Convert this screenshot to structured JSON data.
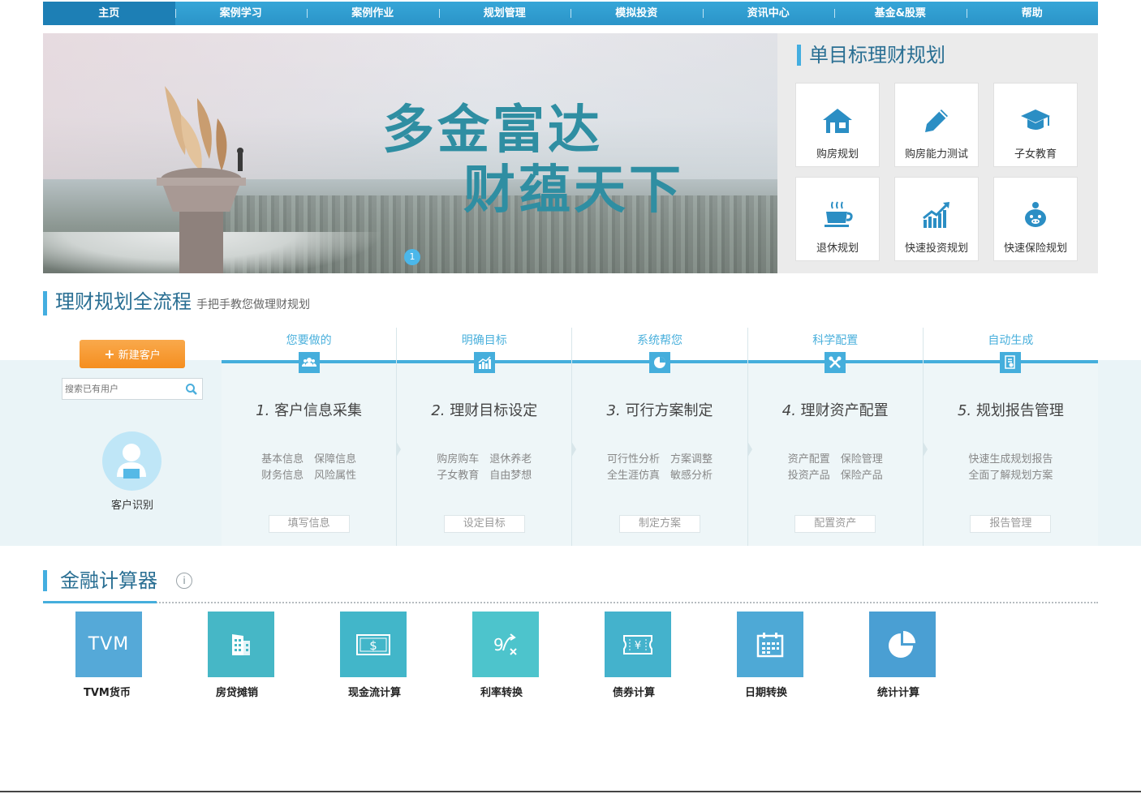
{
  "nav": {
    "items": [
      "主页",
      "案例学习",
      "案例作业",
      "规划管理",
      "模拟投资",
      "资讯中心",
      "基金&股票",
      "帮助"
    ]
  },
  "banner": {
    "slogan_line1": "多金富达",
    "slogan_line2": "财蕴天下",
    "slide_indicator": "1"
  },
  "goal_panel": {
    "title": "单目标理财规划",
    "items": [
      {
        "label": "购房规划",
        "icon": "house-icon"
      },
      {
        "label": "购房能力测试",
        "icon": "pencil-icon"
      },
      {
        "label": "子女教育",
        "icon": "graduation-cap-icon"
      },
      {
        "label": "退休规划",
        "icon": "coffee-cup-icon"
      },
      {
        "label": "快速投资规划",
        "icon": "rising-chart-icon"
      },
      {
        "label": "快速保险规划",
        "icon": "piggy-bank-icon"
      }
    ]
  },
  "process": {
    "title": "理财规划全流程",
    "subtitle": "手把手教您做理财规划",
    "new_client_label": "新建客户",
    "search_placeholder": "搜索已有用户",
    "client_id_label": "客户识别",
    "steps": [
      {
        "head": "您要做的",
        "num": "1.",
        "title": "客户信息采集",
        "desc1": "基本信息　保障信息",
        "desc2": "财务信息　风险属性",
        "button": "填写信息",
        "icon": "group-icon"
      },
      {
        "head": "明确目标",
        "num": "2.",
        "title": "理财目标设定",
        "desc1": "购房购车　退休养老",
        "desc2": "子女教育　自由梦想",
        "button": "设定目标",
        "icon": "bar-chart-icon"
      },
      {
        "head": "系统帮您",
        "num": "3.",
        "title": "可行方案制定",
        "desc1": "可行性分析　方案调整",
        "desc2": "全生涯仿真　敏感分析",
        "button": "制定方案",
        "icon": "pie-chart-icon"
      },
      {
        "head": "科学配置",
        "num": "4.",
        "title": "理财资产配置",
        "desc1": "资产配置　保险管理",
        "desc2": "投资产品　保险产品",
        "button": "配置资产",
        "icon": "tools-icon"
      },
      {
        "head": "自动生成",
        "num": "5.",
        "title": "规划报告管理",
        "desc1": "快速生成规划报告",
        "desc2": "全面了解规划方案",
        "button": "报告管理",
        "icon": "report-icon"
      }
    ]
  },
  "calculators": {
    "title": "金融计算器",
    "info": "i",
    "items": [
      {
        "label": "TVM货币",
        "tile_text": "TVM",
        "color": "#55a9d8",
        "icon": "tvm-text"
      },
      {
        "label": "房贷摊销",
        "tile_text": "",
        "color": "#46b7c6",
        "icon": "building-icon"
      },
      {
        "label": "现金流计算",
        "tile_text": "",
        "color": "#42b6c9",
        "icon": "cash-icon"
      },
      {
        "label": "利率转换",
        "tile_text": "",
        "color": "#4dc4cc",
        "icon": "rate-convert-icon"
      },
      {
        "label": "债券计算",
        "tile_text": "",
        "color": "#44b2cc",
        "icon": "bond-ticket-icon"
      },
      {
        "label": "日期转换",
        "tile_text": "",
        "color": "#4ea9d6",
        "icon": "calendar-icon"
      },
      {
        "label": "统计计算",
        "tile_text": "",
        "color": "#4a9fd3",
        "icon": "stats-pie-icon"
      }
    ]
  }
}
